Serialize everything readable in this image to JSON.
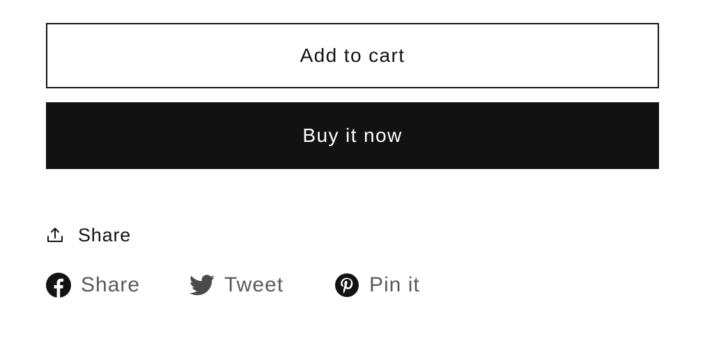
{
  "product_form": {
    "add_to_cart_label": "Add to cart",
    "buy_now_label": "Buy it now"
  },
  "share": {
    "toggle_label": "Share",
    "toggle_icon": "share-upload-icon"
  },
  "social": [
    {
      "label": "Share",
      "icon": "facebook-icon"
    },
    {
      "label": "Tweet",
      "icon": "twitter-icon"
    },
    {
      "label": "Pin it",
      "icon": "pinterest-icon"
    }
  ],
  "colors": {
    "primary": "#121212",
    "background": "#ffffff",
    "social_text": "#5a5a5a"
  }
}
